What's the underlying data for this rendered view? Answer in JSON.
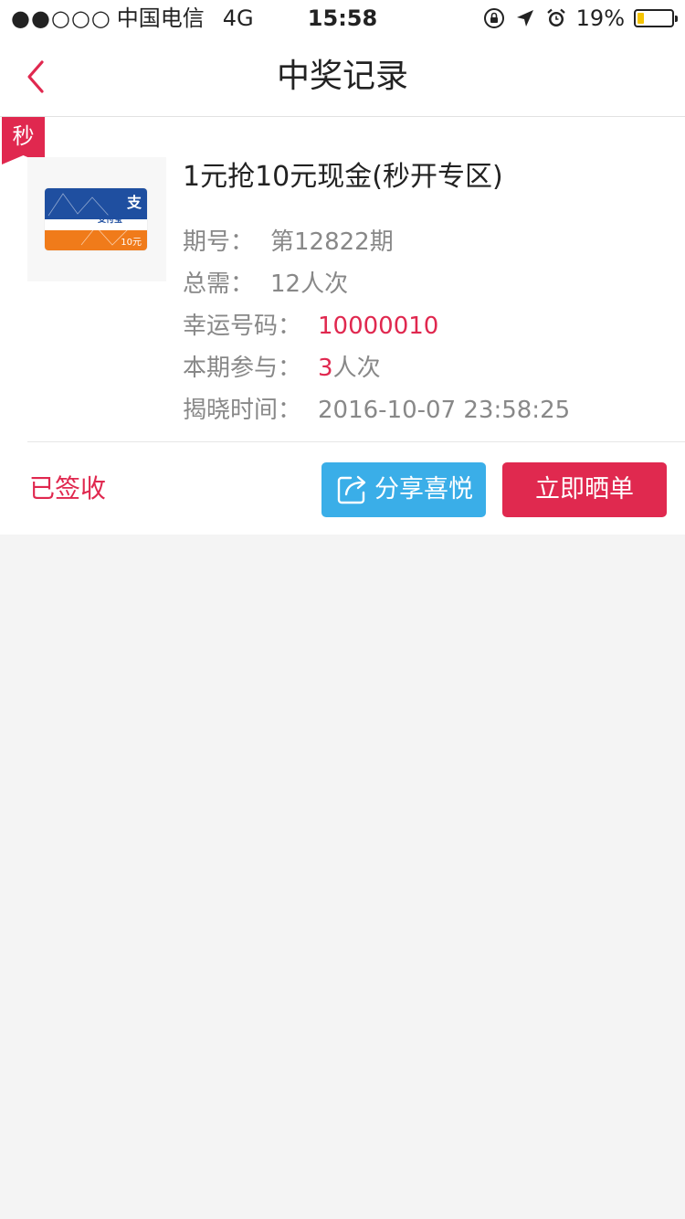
{
  "status_bar": {
    "signal": "●●○○○",
    "carrier": "中国电信",
    "network": "4G",
    "time": "15:58",
    "battery_percent": "19%",
    "battery_level": 0.19,
    "battery_color": "#f5c400"
  },
  "nav": {
    "title": "中奖记录",
    "back_icon": "chevron-left-icon",
    "accent_color": "#e0284f"
  },
  "record": {
    "badge": "秒",
    "product_image": {
      "brand": "支付宝",
      "logo": "支",
      "value": "10元"
    },
    "title": "1元抢10元现金(秒开专区)",
    "period_label": "期号：",
    "period_value": "第12822期",
    "total_label": "总需：",
    "total_value": "12人次",
    "lucky_label": "幸运号码：",
    "lucky_value": "10000010",
    "join_label": "本期参与：",
    "join_count": "3",
    "join_unit": "人次",
    "reveal_label": "揭晓时间：",
    "reveal_value": "2016-10-07 23:58:25",
    "status": "已签收",
    "share_label": "分享喜悦",
    "share_icon": "share-icon",
    "show_label": "立即晒单"
  },
  "colors": {
    "red": "#e0284f",
    "blue": "#3aaee8",
    "background": "#f4f4f4"
  }
}
